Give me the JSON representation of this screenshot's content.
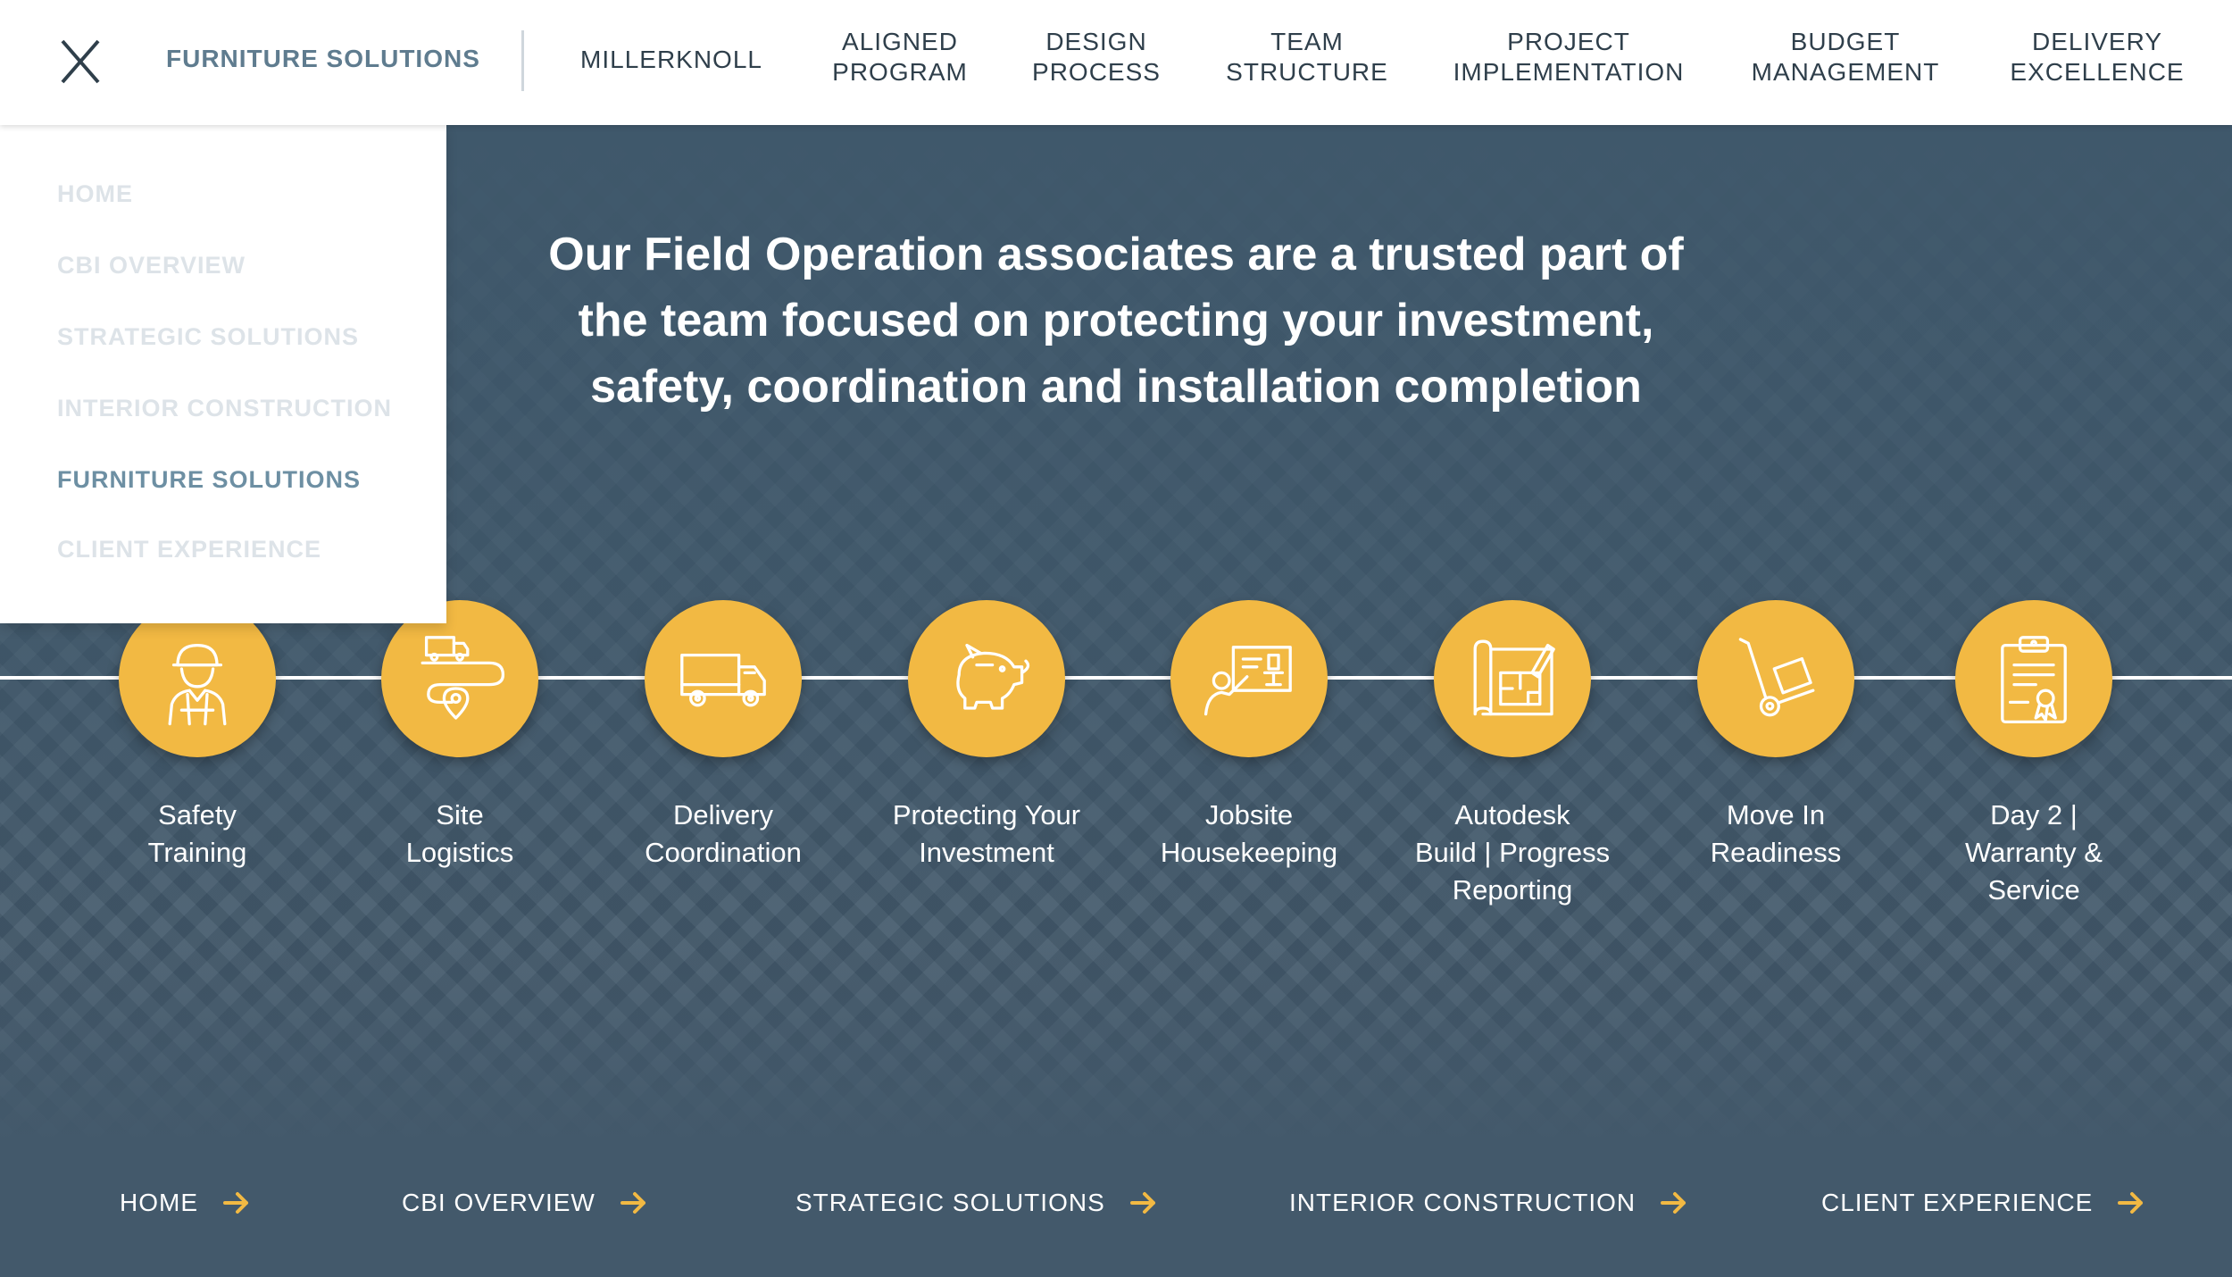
{
  "header": {
    "brand": "FURNITURE SOLUTIONS",
    "nav": [
      {
        "label": "MILLERKNOLL"
      },
      {
        "label": "ALIGNED\nPROGRAM"
      },
      {
        "label": "DESIGN\nPROCESS"
      },
      {
        "label": "TEAM\nSTRUCTURE"
      },
      {
        "label": "PROJECT\nIMPLEMENTATION"
      },
      {
        "label": "BUDGET\nMANAGEMENT"
      },
      {
        "label": "DELIVERY\nEXCELLENCE"
      }
    ]
  },
  "menu": {
    "items": [
      {
        "label": "HOME"
      },
      {
        "label": "CBI OVERVIEW"
      },
      {
        "label": "STRATEGIC SOLUTIONS"
      },
      {
        "label": "INTERIOR CONSTRUCTION"
      },
      {
        "label": "FURNITURE SOLUTIONS"
      },
      {
        "label": "CLIENT EXPERIENCE"
      }
    ],
    "active": "FURNITURE SOLUTIONS"
  },
  "hero": {
    "line1": "Our Field Operation associates are a trusted part of",
    "line2": "the team focused on protecting your investment,",
    "line3": "safety, coordination and installation completion"
  },
  "steps": [
    {
      "label": "Safety\nTraining",
      "icon": "worker-icon"
    },
    {
      "label": "Site\nLogistics",
      "icon": "route-truck-icon"
    },
    {
      "label": "Delivery\nCoordination",
      "icon": "delivery-truck-icon"
    },
    {
      "label": "Protecting Your\nInvestment",
      "icon": "piggy-bank-icon"
    },
    {
      "label": "Jobsite\nHousekeeping",
      "icon": "presentation-icon"
    },
    {
      "label": "Autodesk\nBuild | Progress\nReporting",
      "icon": "blueprint-icon"
    },
    {
      "label": "Move In\nReadiness",
      "icon": "hand-truck-icon"
    },
    {
      "label": "Day 2 |\nWarranty &\nService",
      "icon": "clipboard-award-icon"
    }
  ],
  "footer_links": [
    {
      "label": "HOME"
    },
    {
      "label": "CBI OVERVIEW"
    },
    {
      "label": "STRATEGIC SOLUTIONS"
    },
    {
      "label": "INTERIOR CONSTRUCTION"
    },
    {
      "label": "CLIENT EXPERIENCE"
    }
  ],
  "colors": {
    "accent": "#f2b943",
    "background": "#43596b",
    "brand_text": "#5f7c8f"
  }
}
